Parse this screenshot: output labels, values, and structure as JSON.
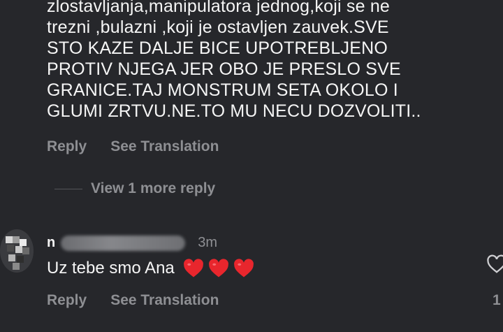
{
  "comment": {
    "lines": [
      "zlostavljanja,manipulatora jednog,koji se ne",
      "trezni ,bulazni ,koji je ostavljen zauvek.SVE",
      "STO KAZE DALJE BICE UPOTREBLJENO",
      "PROTIV NJEGA JER OBO JE PRESLO SVE",
      "GRANICE.TAJ MONSTRUM SETA OKOLO I",
      "GLUMI ZRTVU.NE.TO MU NECU DOZVOLITI.."
    ],
    "reply_label": "Reply",
    "translate_label": "See Translation",
    "view_more_label": "View 1 more reply"
  },
  "reply": {
    "username_initial": "n",
    "timestamp": "3m",
    "text": "Uz tebe smo Ana",
    "hearts": [
      "heart-emoji",
      "heart-emoji",
      "heart-emoji"
    ],
    "reply_label": "Reply",
    "translate_label": "See Translation",
    "like_count": "1"
  },
  "colors": {
    "background": "#26272b",
    "text": "#f5f5f5",
    "muted": "#8e8f93",
    "heart": "#e8262d"
  }
}
